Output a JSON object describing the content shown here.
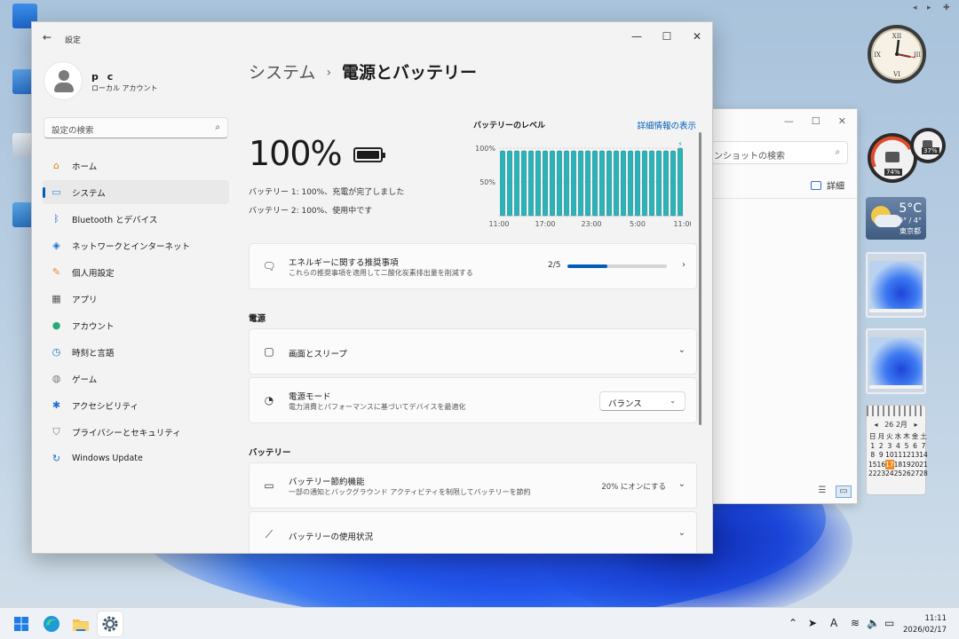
{
  "window": {
    "title": "設定",
    "back_icon": "←",
    "minimize": "—",
    "maximize": "☐",
    "close": "✕"
  },
  "user": {
    "name": "p c",
    "type": "ローカル アカウント"
  },
  "search": {
    "placeholder": "設定の検索"
  },
  "nav": [
    {
      "label": "ホーム",
      "icon": "home-icon"
    },
    {
      "label": "システム",
      "icon": "system-icon",
      "selected": true
    },
    {
      "label": "Bluetooth とデバイス",
      "icon": "bluetooth-icon"
    },
    {
      "label": "ネットワークとインターネット",
      "icon": "wifi-icon"
    },
    {
      "label": "個人用設定",
      "icon": "brush-icon"
    },
    {
      "label": "アプリ",
      "icon": "apps-icon"
    },
    {
      "label": "アカウント",
      "icon": "account-icon"
    },
    {
      "label": "時刻と言語",
      "icon": "globe-clock-icon"
    },
    {
      "label": "ゲーム",
      "icon": "gamepad-icon"
    },
    {
      "label": "アクセシビリティ",
      "icon": "accessibility-icon"
    },
    {
      "label": "プライバシーとセキュリティ",
      "icon": "shield-icon"
    },
    {
      "label": "Windows Update",
      "icon": "update-icon"
    }
  ],
  "breadcrumb": {
    "parent": "システム",
    "separator": "›",
    "current": "電源とバッテリー"
  },
  "battery": {
    "percent": "100%",
    "battery1": "バッテリー 1:  100%、充電が完了しました",
    "battery2": "バッテリー 2:  100%、使用中です"
  },
  "level_chart": {
    "title": "バッテリーのレベル",
    "more_link": "詳細情報の表示"
  },
  "chart_data": {
    "type": "bar",
    "title": "バッテリーのレベル",
    "y_ticks": [
      "100%",
      "50%"
    ],
    "x_ticks": [
      "11:00",
      "17:00",
      "23:00",
      "5:00",
      "11:00"
    ],
    "ylim": [
      0,
      100
    ],
    "values": [
      96,
      96,
      96,
      96,
      96,
      96,
      96,
      96,
      96,
      96,
      96,
      96,
      96,
      96,
      96,
      96,
      96,
      96,
      96,
      96,
      96,
      96,
      96,
      96,
      96,
      100
    ],
    "charging_marker": "⚡",
    "color": "#2ab3b8"
  },
  "recommendation": {
    "title": "エネルギーに関する推奨事項",
    "subtitle": "これらの推奨事項を適用して二酸化炭素排出量を削減する",
    "progress_text": "2/5",
    "progress_fraction": 0.4
  },
  "power_section": {
    "heading": "電源"
  },
  "screen_sleep": {
    "title": "画面とスリープ"
  },
  "power_mode": {
    "title": "電源モード",
    "subtitle": "電力消費とパフォーマンスに基づいてデバイスを最適化",
    "value": "バランス"
  },
  "battery_section": {
    "heading": "バッテリー"
  },
  "saver": {
    "title": "バッテリー節約機能",
    "subtitle": "一部の通知とバックグラウンド アクティビティを制限してバッテリーを節約",
    "value": "20% にオンにする"
  },
  "usage": {
    "title": "バッテリーの使用状況"
  },
  "bg_window": {
    "search": "ンショットの検索",
    "details": "詳細"
  },
  "weather": {
    "temp": "5°C",
    "range": "9° / 4°",
    "location": "東京都"
  },
  "gauges": {
    "left": "74%",
    "right": "37%"
  },
  "calendar": {
    "header": "26 2月",
    "days": [
      "日",
      "月",
      "火",
      "水",
      "木",
      "金",
      "土"
    ],
    "weeks": [
      [
        "1",
        "2",
        "3",
        "4",
        "5",
        "6",
        "7"
      ],
      [
        "8",
        "9",
        "10",
        "11",
        "12",
        "13",
        "14"
      ],
      [
        "15",
        "16",
        "17",
        "18",
        "19",
        "20",
        "21"
      ],
      [
        "22",
        "23",
        "24",
        "25",
        "26",
        "27",
        "28"
      ]
    ],
    "today": "17"
  },
  "taskbar": {
    "time": "11:11",
    "date": "2026/02/17",
    "ime": "A"
  }
}
